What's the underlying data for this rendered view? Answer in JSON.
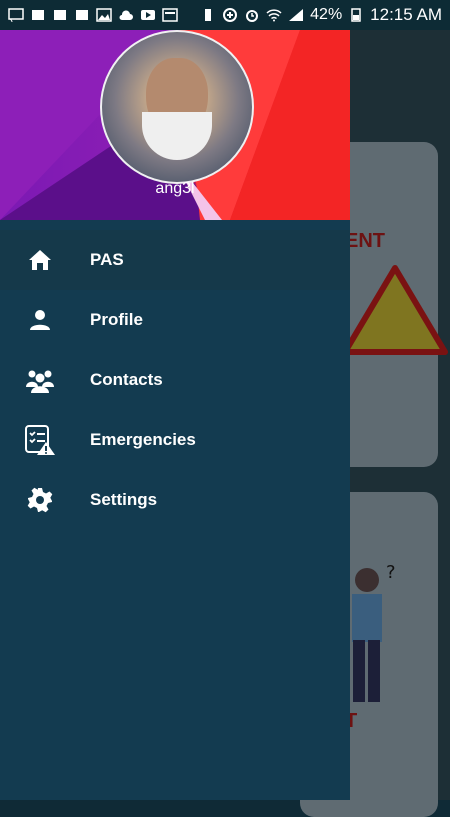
{
  "status_bar": {
    "battery": "42%",
    "time": "12:15 AM"
  },
  "drawer": {
    "username": "ang3l",
    "items": [
      {
        "label": "PAS",
        "icon": "home-icon",
        "active": true
      },
      {
        "label": "Profile",
        "icon": "person-icon",
        "active": false
      },
      {
        "label": "Contacts",
        "icon": "people-icon",
        "active": false
      },
      {
        "label": "Emergencies",
        "icon": "emergency-list-icon",
        "active": false
      },
      {
        "label": "Settings",
        "icon": "gear-icon",
        "active": false
      }
    ]
  },
  "background": {
    "card1_text": "ENT",
    "card2_text": "T"
  },
  "colors": {
    "drawer": "#133b50",
    "accent_purple": "#7b19b3",
    "accent_red": "#f52a2a"
  }
}
